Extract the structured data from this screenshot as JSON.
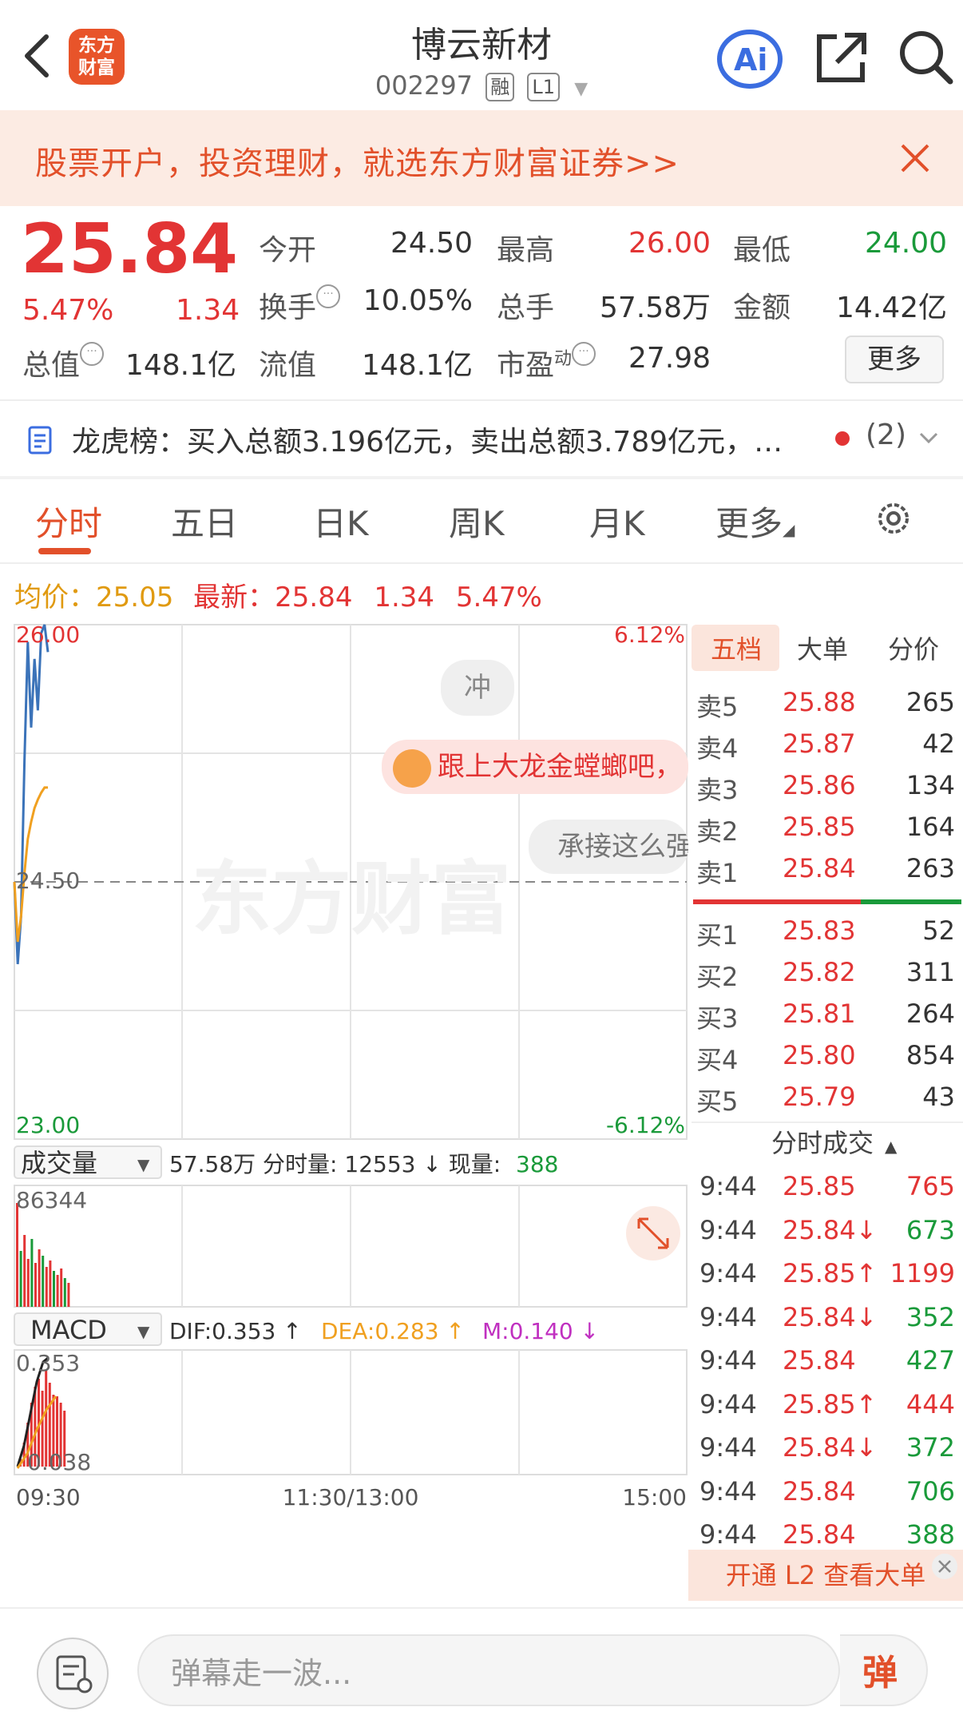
{
  "header": {
    "stock_name": "博云新材",
    "stock_code": "002297",
    "tag_margin": "融",
    "tag_level": "L1",
    "logo_line1": "东方",
    "logo_line2": "财富"
  },
  "banner": {
    "text": "股票开户，投资理财，就选东方财富证券>>"
  },
  "quote": {
    "price": "25.84",
    "change_pct": "5.47%",
    "change": "1.34",
    "open_label": "今开",
    "open": "24.50",
    "high_label": "最高",
    "high": "26.00",
    "low_label": "最低",
    "low": "24.00",
    "turnover_label": "换手",
    "turnover": "10.05%",
    "volume_label": "总手",
    "volume": "57.58万",
    "amount_label": "金额",
    "amount": "14.42亿",
    "mktcap_label": "总值",
    "mktcap": "148.1亿",
    "float_label": "流值",
    "float_cap": "148.1亿",
    "pe_label": "市盈",
    "pe_sup": "动",
    "pe": "27.98",
    "more": "更多"
  },
  "dragon_tiger": {
    "text": "龙虎榜：买入总额3.196亿元，卖出总额3.789亿元，…",
    "count": "(2)"
  },
  "tabs": [
    "分时",
    "五日",
    "日K",
    "周K",
    "月K",
    "更多"
  ],
  "avg_bar": {
    "avg_label": "均价：",
    "avg": "25.05",
    "latest_label": "最新：",
    "latest": "25.84",
    "chg": "1.34",
    "pct": "5.47%"
  },
  "chart": {
    "y_top": "26.00",
    "y_mid": "24.50",
    "y_bottom": "23.00",
    "pct_top": "6.12%",
    "pct_bottom": "-6.12%",
    "x_start": "09:30",
    "x_mid": "11:30/13:00",
    "x_end": "15:00",
    "watermark": "东方财富",
    "volume_selector": "成交量",
    "volume_info": "57.58万 分时量: 12553 ↓ 现量:",
    "volume_now": "388",
    "volume_max": "86344",
    "macd_selector": "MACD",
    "dif": "DIF:0.353 ↑",
    "dea": "DEA:0.283 ↑",
    "m": "M:0.140 ↓",
    "macd_top": "0.353",
    "macd_bottom": "0.038",
    "colors": {
      "price_line": "#3b73b9",
      "avg_line": "#f0a020",
      "up": "#e23434",
      "down": "#1a9a3a"
    }
  },
  "chart_data": {
    "type": "line",
    "series": [
      {
        "values": [
          24.5,
          24.02,
          24.3,
          25.2,
          25.9,
          25.4,
          25.8,
          25.5,
          25.95,
          26.0,
          25.84
        ]
      },
      {
        "values": [
          24.5,
          24.15,
          24.3,
          24.55,
          24.75,
          24.85,
          24.93,
          24.98,
          25.02,
          25.05,
          25.05
        ]
      }
    ],
    "ylim": [
      23.0,
      26.0
    ]
  },
  "danmaku": {
    "bubble1": "冲",
    "bubble2": "跟上大龙金螳螂吧，",
    "bubble3": "承接这么强"
  },
  "orderbook": {
    "tabs": [
      "五档",
      "大单",
      "分价"
    ],
    "asks": [
      {
        "label": "卖5",
        "price": "25.88",
        "vol": "265"
      },
      {
        "label": "卖4",
        "price": "25.87",
        "vol": "42"
      },
      {
        "label": "卖3",
        "price": "25.86",
        "vol": "134"
      },
      {
        "label": "卖2",
        "price": "25.85",
        "vol": "164"
      },
      {
        "label": "卖1",
        "price": "25.84",
        "vol": "263"
      }
    ],
    "bids": [
      {
        "label": "买1",
        "price": "25.83",
        "vol": "52"
      },
      {
        "label": "买2",
        "price": "25.82",
        "vol": "311"
      },
      {
        "label": "买3",
        "price": "25.81",
        "vol": "264"
      },
      {
        "label": "买4",
        "price": "25.80",
        "vol": "854"
      },
      {
        "label": "买5",
        "price": "25.79",
        "vol": "43"
      }
    ],
    "ticks_title": "分时成交",
    "ticks": [
      {
        "t": "9:44",
        "p": "25.85",
        "v": "765",
        "dir": "up"
      },
      {
        "t": "9:44",
        "p": "25.84↓",
        "v": "673",
        "dir": "down"
      },
      {
        "t": "9:44",
        "p": "25.85↑",
        "v": "1199",
        "dir": "up"
      },
      {
        "t": "9:44",
        "p": "25.84↓",
        "v": "352",
        "dir": "down"
      },
      {
        "t": "9:44",
        "p": "25.84",
        "v": "427",
        "dir": "down"
      },
      {
        "t": "9:44",
        "p": "25.85↑",
        "v": "444",
        "dir": "up"
      },
      {
        "t": "9:44",
        "p": "25.84↓",
        "v": "372",
        "dir": "down"
      },
      {
        "t": "9:44",
        "p": "25.84",
        "v": "706",
        "dir": "down"
      },
      {
        "t": "9:44",
        "p": "25.84",
        "v": "388",
        "dir": "down"
      }
    ],
    "l2": "开通 L2 查看大单"
  },
  "bottom": {
    "placeholder": "弹幕走一波...",
    "send": "弹"
  }
}
